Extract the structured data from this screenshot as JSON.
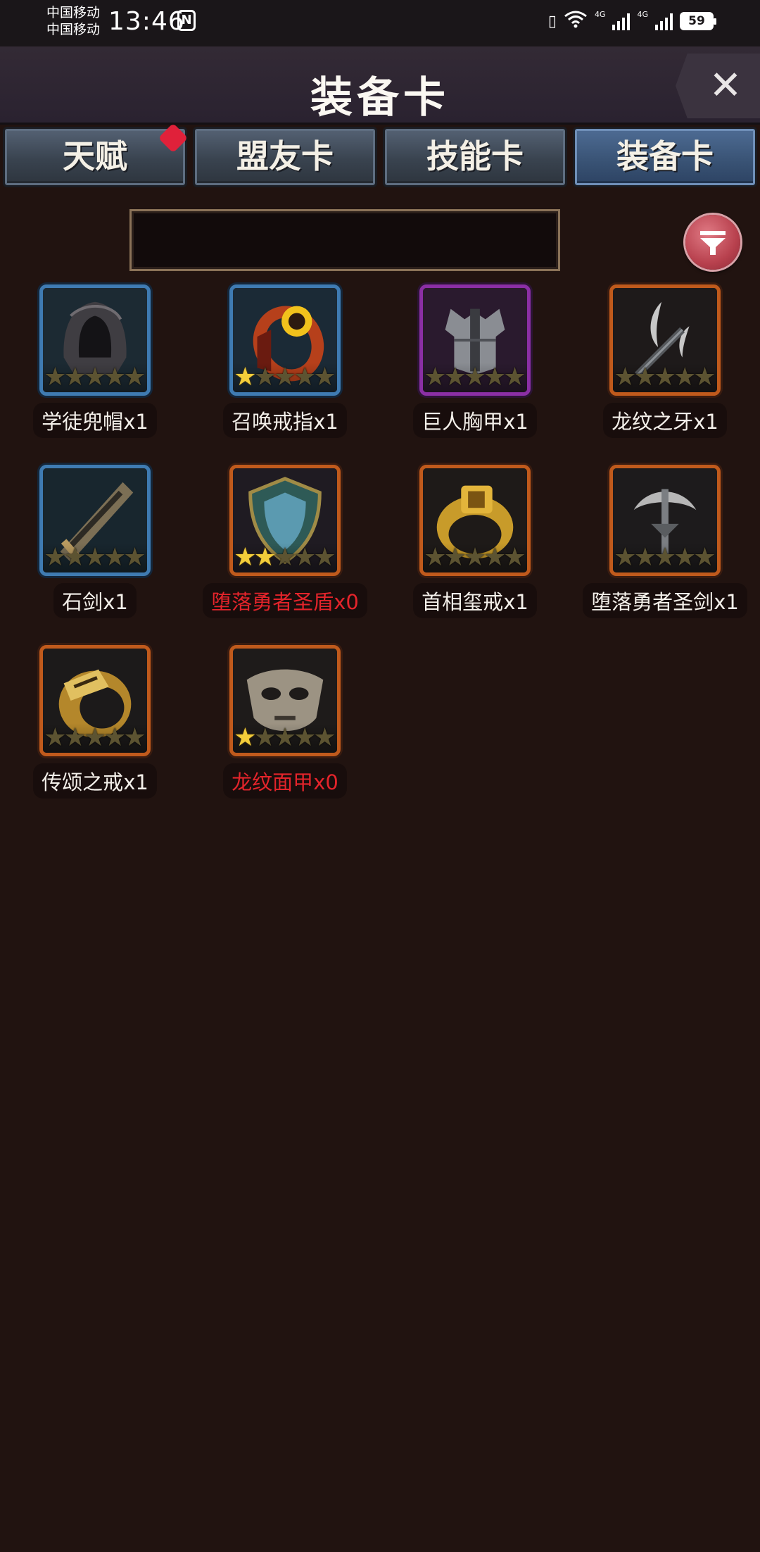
{
  "status": {
    "carrier1": "中国移动",
    "carrier2": "中国移动",
    "time": "13:46",
    "nfc": "N",
    "net1": "4G",
    "net2": "4G",
    "battery": "59"
  },
  "header": {
    "title": "装备卡",
    "close_icon": "close-icon"
  },
  "tabs": [
    {
      "label": "天赋",
      "badge": true
    },
    {
      "label": "盟友卡"
    },
    {
      "label": "技能卡"
    },
    {
      "label": "装备卡",
      "active": true
    }
  ],
  "search": {
    "value": "",
    "placeholder": ""
  },
  "filter": {
    "icon": "filter-icon"
  },
  "items": [
    {
      "name": "学徒兜帽",
      "count": "x1",
      "stars": 0,
      "rarity": "blue",
      "owned": true
    },
    {
      "name": "召唤戒指",
      "count": "x1",
      "stars": 1,
      "rarity": "blue",
      "owned": true
    },
    {
      "name": "巨人胸甲",
      "count": "x1",
      "stars": 0,
      "rarity": "purple",
      "owned": true
    },
    {
      "name": "龙纹之牙",
      "count": "x1",
      "stars": 0,
      "rarity": "orange",
      "owned": true
    },
    {
      "name": "石剑",
      "count": "x1",
      "stars": 0,
      "rarity": "blue",
      "owned": true
    },
    {
      "name": "堕落勇者圣盾",
      "count": "x0",
      "stars": 2,
      "rarity": "orange",
      "owned": false
    },
    {
      "name": "首相玺戒",
      "count": "x1",
      "stars": 0,
      "rarity": "orange",
      "owned": true
    },
    {
      "name": "堕落勇者圣剑",
      "count": "x1",
      "stars": 0,
      "rarity": "orange",
      "owned": true
    },
    {
      "name": "传颂之戒",
      "count": "x1",
      "stars": 0,
      "rarity": "orange",
      "owned": true
    },
    {
      "name": "龙纹面甲",
      "count": "x0",
      "stars": 1,
      "rarity": "orange",
      "owned": false
    }
  ],
  "colors": {
    "background": "#211310",
    "frame_orange": "#c05a1c",
    "frame_blue": "#3f7bb2",
    "frame_purple": "#8b2fa5",
    "star_on": "#f3cd3a",
    "missing_text": "#e3242b"
  }
}
